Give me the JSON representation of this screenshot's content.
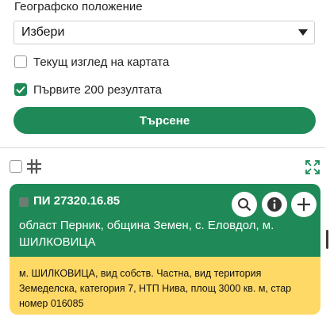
{
  "filter": {
    "section_label": "Географско положение",
    "select_value": "Избери",
    "select_arrow_icon": "triangle-down-icon",
    "current_view_label": "Текущ изглед на картата",
    "current_view_checked": false,
    "first_200_label": "Първите 200 резултата",
    "first_200_checked": true,
    "search_button": "Търсене"
  },
  "toolbar": {
    "select_all_checked": false,
    "grid_icon": "grid-icon",
    "expand_icon": "expand-icon"
  },
  "result": {
    "title": "ПИ 27320.16.85",
    "address": "област Перник, община Земен, с. Еловдол, м. ШИЛКОВИЦА",
    "description": "м. ШИЛКОВИЦА, вид собств. Частна, вид територия Земеделска, категория 7, НТП Нива, площ 3000 кв. м, стар номер 016085",
    "actions": [
      "search-icon",
      "info-icon",
      "plus-icon"
    ]
  },
  "colors": {
    "accent": "#1f8a57",
    "card_body": "#ffd966"
  }
}
